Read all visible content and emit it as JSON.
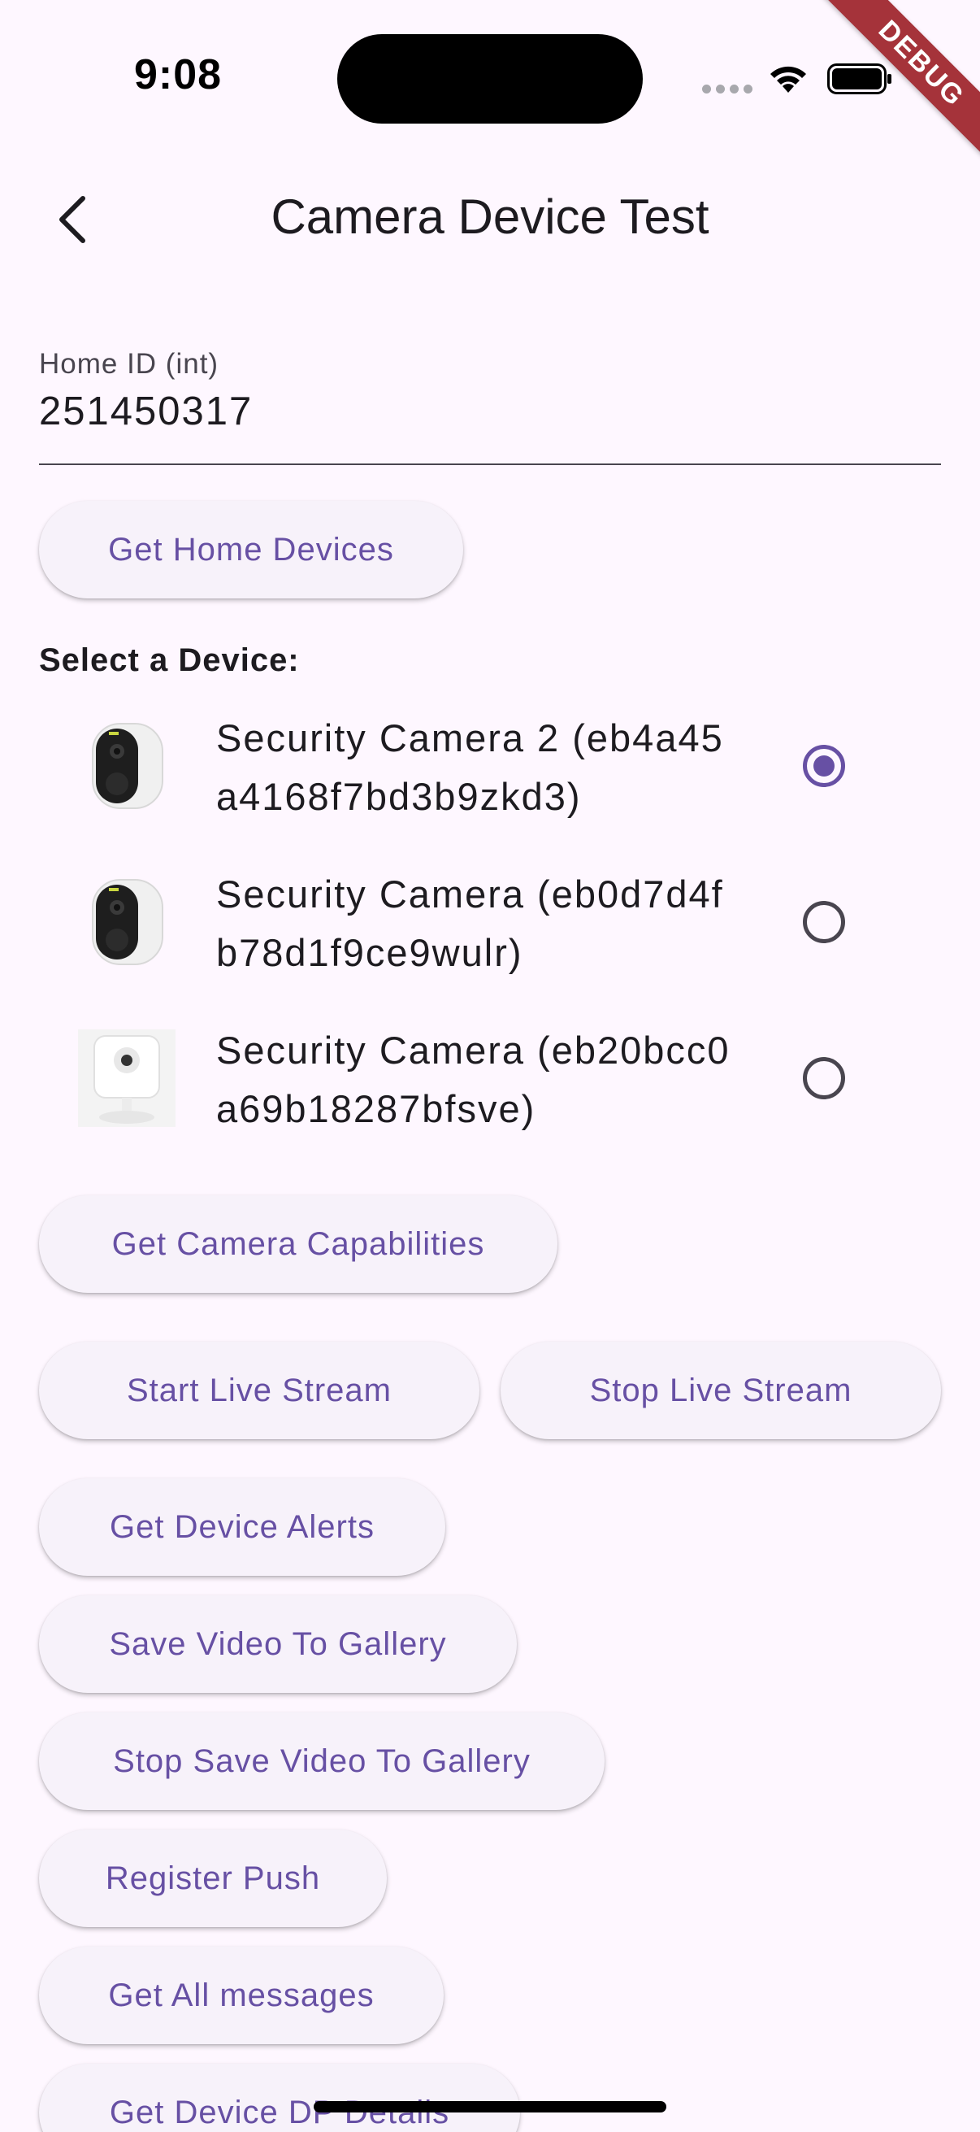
{
  "status_bar": {
    "time": "9:08",
    "debug_label": "DEBUG",
    "wifi_icon": "wifi-icon",
    "battery_icon": "battery-icon"
  },
  "app_bar": {
    "back_icon": "chevron-left-icon",
    "title": "Camera Device Test"
  },
  "home_id_field": {
    "label": "Home ID (int)",
    "value": "251450317"
  },
  "buttons": {
    "get_home_devices": "Get Home Devices",
    "get_camera_capabilities": "Get Camera Capabilities",
    "start_live_stream": "Start Live Stream",
    "stop_live_stream": "Stop Live Stream",
    "get_device_alerts": "Get Device Alerts",
    "save_video_to_gallery": "Save Video To Gallery",
    "stop_save_video_to_gallery": "Stop Save Video To Gallery",
    "register_push": "Register Push",
    "get_all_messages": "Get All messages",
    "get_device_dp_details": "Get Device DP Details"
  },
  "device_section": {
    "label": "Select a Device:",
    "devices": [
      {
        "name": "Security Camera 2 (eb4a45a4168f7bd3b9zkd3)",
        "selected": true
      },
      {
        "name": "Security Camera (eb0d7d4fb78d1f9ce9wulr)",
        "selected": false
      },
      {
        "name": "Security Camera (eb20bcc0a69b18287bfsve)",
        "selected": false
      }
    ]
  },
  "colors": {
    "background": "#fef7ff",
    "accent": "#6750a4",
    "button_surface": "#f7f2fa",
    "debug_banner": "#a5333a"
  }
}
